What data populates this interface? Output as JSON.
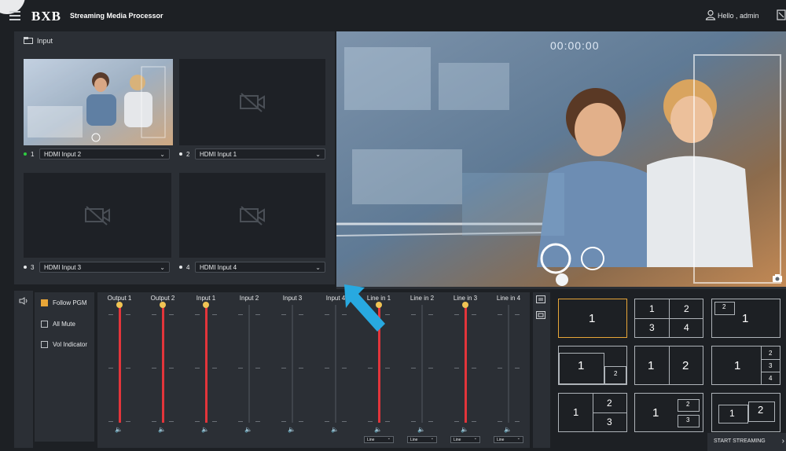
{
  "header": {
    "logo": "BXB",
    "title": "Streaming Media Processor",
    "greeting": "Hello , admin"
  },
  "input_panel": {
    "title": "Input",
    "inputs": [
      {
        "num": "1",
        "selected": "HDMI Input 2",
        "active": true
      },
      {
        "num": "2",
        "selected": "HDMI Input 1",
        "active": false
      },
      {
        "num": "3",
        "selected": "HDMI Input 3",
        "active": false
      },
      {
        "num": "4",
        "selected": "HDMI Input 4",
        "active": false
      }
    ]
  },
  "preview": {
    "timer": "00:00:00"
  },
  "audio": {
    "options": [
      {
        "label": "Follow PGM",
        "checked": true
      },
      {
        "label": "All Mute",
        "checked": false
      },
      {
        "label": "Vol Indicator",
        "checked": false
      }
    ],
    "channels": [
      {
        "name": "Output 1",
        "level": 1.0,
        "line_select": ""
      },
      {
        "name": "Output 2",
        "level": 1.0,
        "line_select": ""
      },
      {
        "name": "Input 1",
        "level": 1.0,
        "line_select": ""
      },
      {
        "name": "Input 2",
        "level": 0.0,
        "line_select": ""
      },
      {
        "name": "Input 3",
        "level": 0.0,
        "line_select": ""
      },
      {
        "name": "Input 4",
        "level": 0.0,
        "line_select": ""
      },
      {
        "name": "Line in 1",
        "level": 1.0,
        "line_select": "Line"
      },
      {
        "name": "Line in 2",
        "level": 0.0,
        "line_select": "Line"
      },
      {
        "name": "Line in 3",
        "level": 1.0,
        "line_select": "Line"
      },
      {
        "name": "Line in 4",
        "level": 0.0,
        "line_select": "Line"
      }
    ]
  },
  "layouts": {
    "items": [
      {
        "labels": [
          "1"
        ]
      },
      {
        "labels": [
          "1",
          "2",
          "3",
          "4"
        ]
      },
      {
        "labels": [
          "2",
          "1"
        ]
      },
      {
        "labels": [
          "1",
          "2"
        ]
      },
      {
        "labels": [
          "1",
          "2"
        ]
      },
      {
        "labels": [
          "1",
          "2",
          "3",
          "4"
        ]
      },
      {
        "labels": [
          "1",
          "2",
          "3"
        ]
      },
      {
        "labels": [
          "1",
          "2",
          "3"
        ]
      },
      {
        "labels": [
          "1",
          "2"
        ]
      }
    ],
    "start_label": "START STREAMING"
  },
  "colors": {
    "accent": "#e8a638",
    "meter": "#e3353b",
    "active_dot": "#2ecc40",
    "panel": "#2b2f35"
  }
}
